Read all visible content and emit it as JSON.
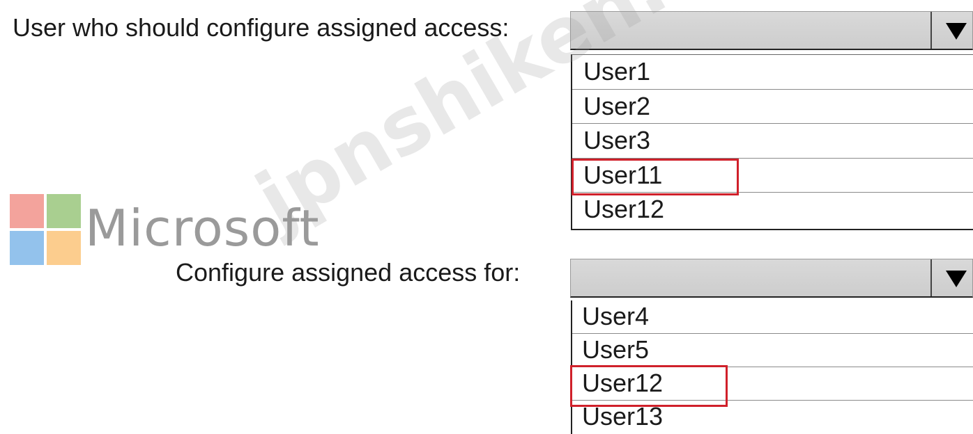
{
  "question": {
    "label1": "User who should configure assigned access:",
    "label2": "Configure assigned access for:"
  },
  "dropdown1": {
    "selected": "",
    "options": [
      "User1",
      "User2",
      "User3",
      "User11",
      "User12"
    ],
    "highlighted": "User11"
  },
  "dropdown2": {
    "selected": "",
    "options": [
      "User4",
      "User5",
      "User12",
      "User13"
    ],
    "highlighted": "User12"
  },
  "logo": {
    "text": "Microsoft",
    "colors": [
      "#f3a39c",
      "#a9cf90",
      "#93c2ec",
      "#fccd8e"
    ]
  },
  "watermark": {
    "text": "jpnshiken.com"
  },
  "colors": {
    "selection_box": "#d0202a",
    "dropdown_bg": "#d4d4d4"
  }
}
